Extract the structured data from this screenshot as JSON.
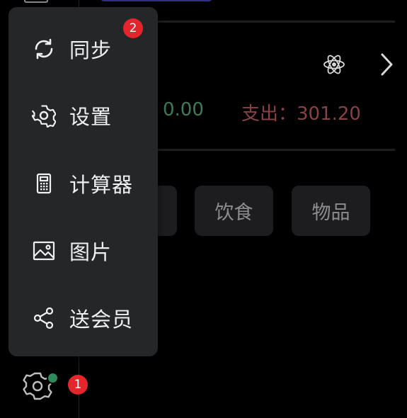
{
  "summary": {
    "income_value": "0.00",
    "expense_text": "支出：301.20"
  },
  "categories": [
    {
      "label": ""
    },
    {
      "label": "饮食"
    },
    {
      "label": "物品"
    }
  ],
  "menu": {
    "items": [
      {
        "label": "同步",
        "icon": "sync-icon"
      },
      {
        "label": "设置",
        "icon": "gear-icon"
      },
      {
        "label": "计算器",
        "icon": "calculator-icon"
      },
      {
        "label": "图片",
        "icon": "image-icon"
      },
      {
        "label": "送会员",
        "icon": "share-icon"
      }
    ]
  },
  "badges": {
    "menu_step": "2",
    "settings_step": "1"
  },
  "colors": {
    "background": "#000000",
    "menu_background": "#252628",
    "income": "#3e7a58",
    "expense": "#8a4044",
    "badge": "#e3262c",
    "status_dot": "#2e8a5c"
  }
}
